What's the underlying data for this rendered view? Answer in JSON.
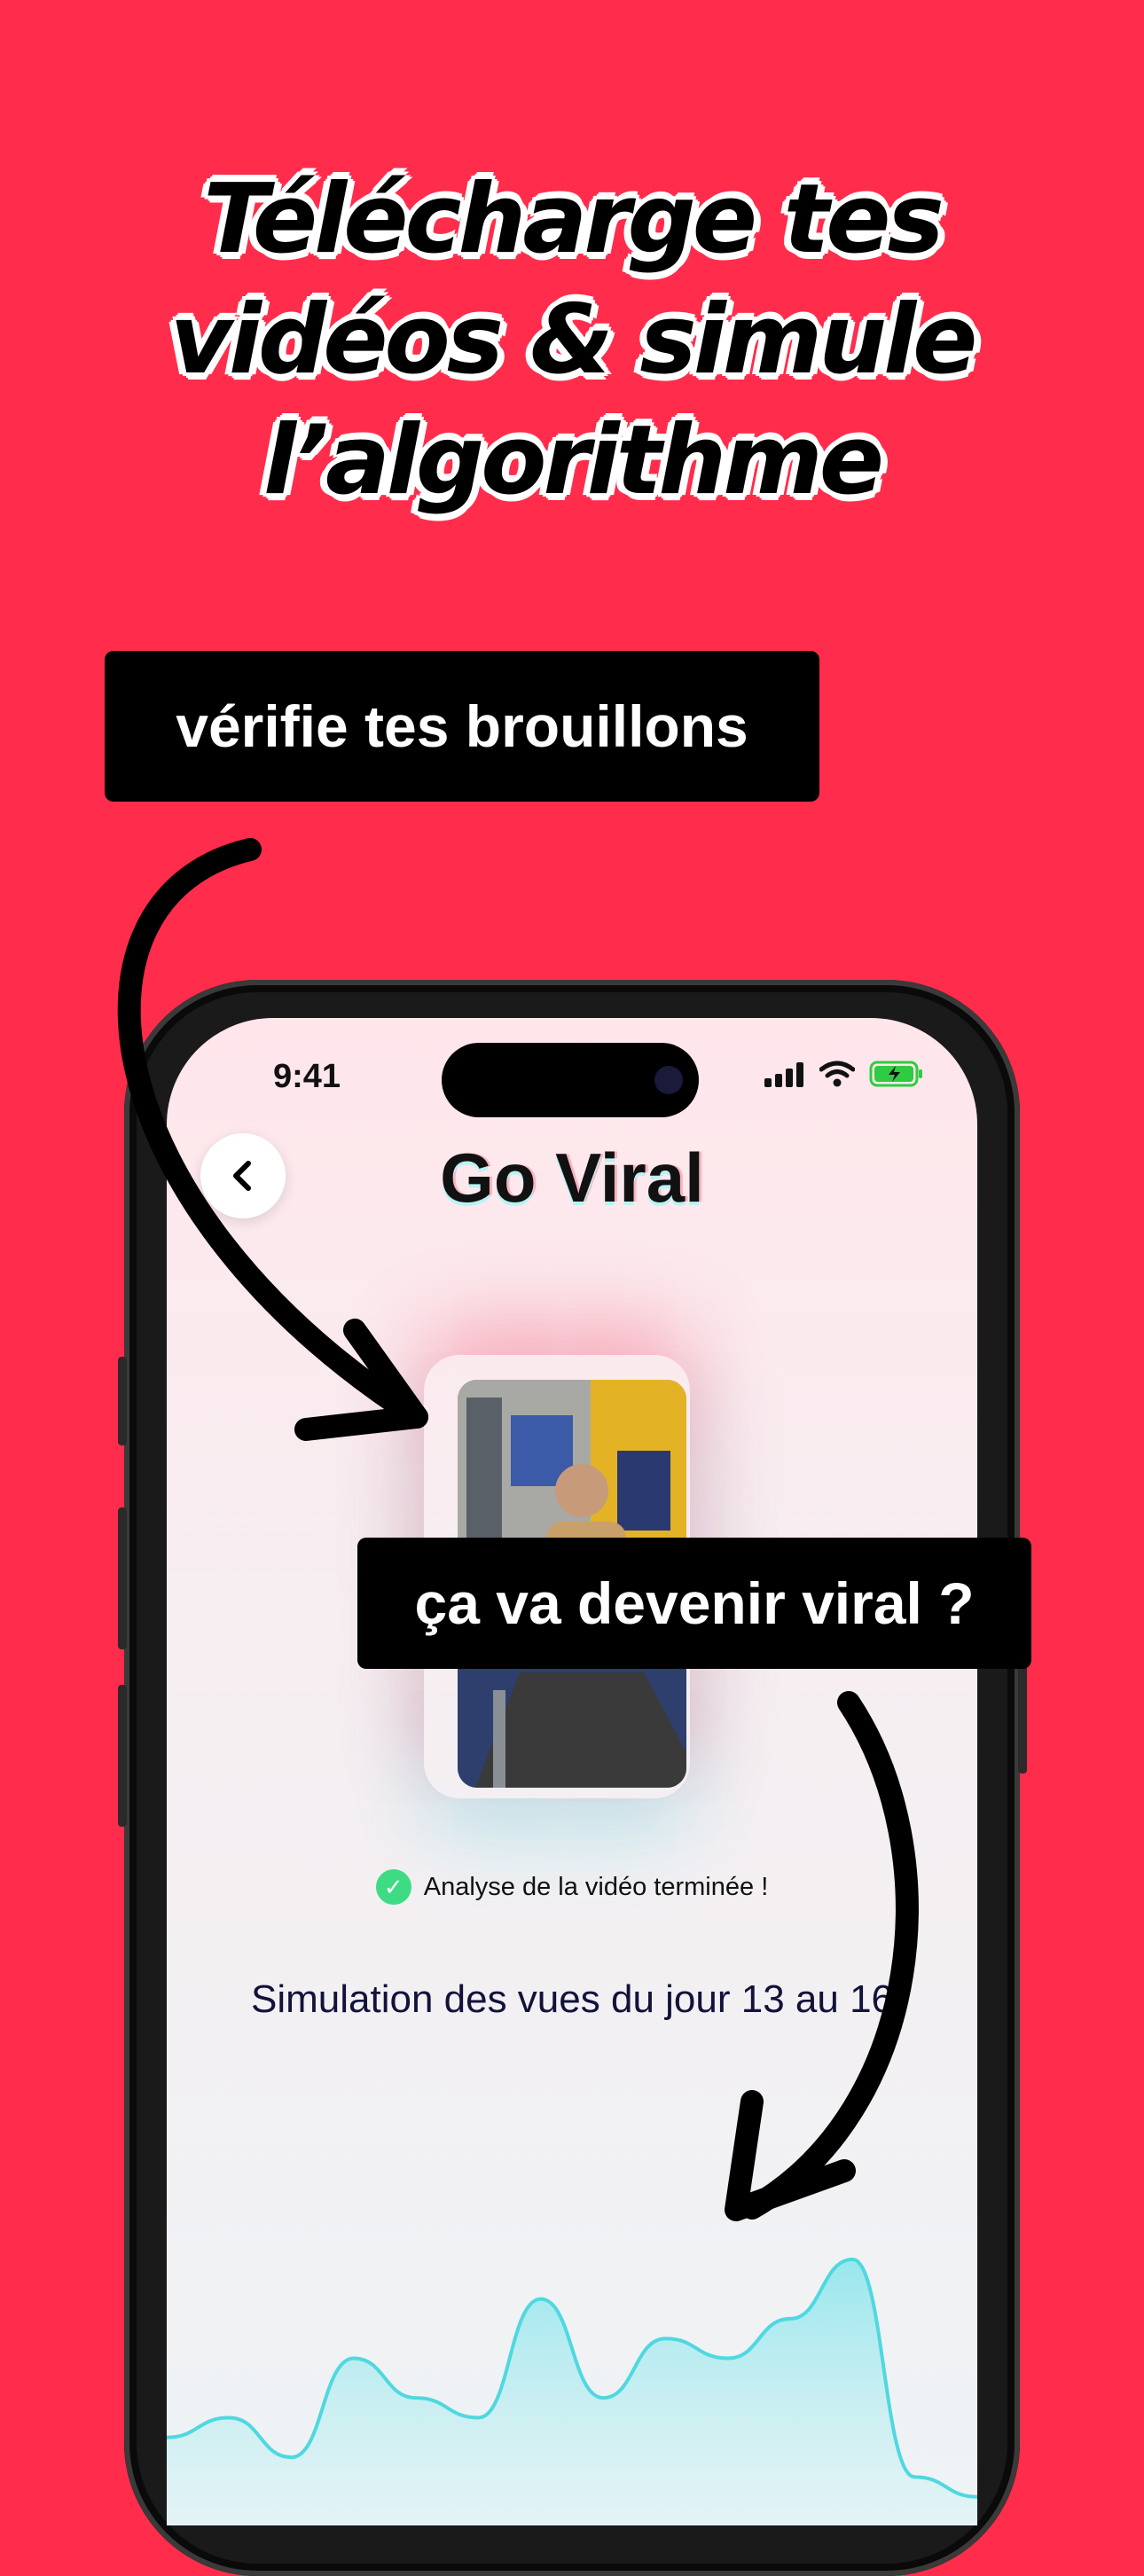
{
  "headline": {
    "line1": "Télécharge tes",
    "line2": "vidéos & simule",
    "line3": "l’algorithme"
  },
  "callouts": {
    "top": "vérifie tes brouillons",
    "middle": "ça va devenir viral ?"
  },
  "status_bar": {
    "time": "9:41"
  },
  "app": {
    "title": "Go Viral",
    "back_icon": "chevron-left-icon",
    "analysis_status": "Analyse de la vidéo terminée !",
    "simulation_title": "Simulation des vues du jour 13 au 16"
  },
  "colors": {
    "background": "#FF2D4B",
    "chart_line": "#4FD8E0",
    "check": "#3DDC84"
  },
  "chart_data": {
    "type": "area",
    "values": [
      4,
      5,
      3,
      8,
      6,
      5,
      11,
      6,
      9,
      8,
      10,
      13,
      2,
      1
    ]
  }
}
